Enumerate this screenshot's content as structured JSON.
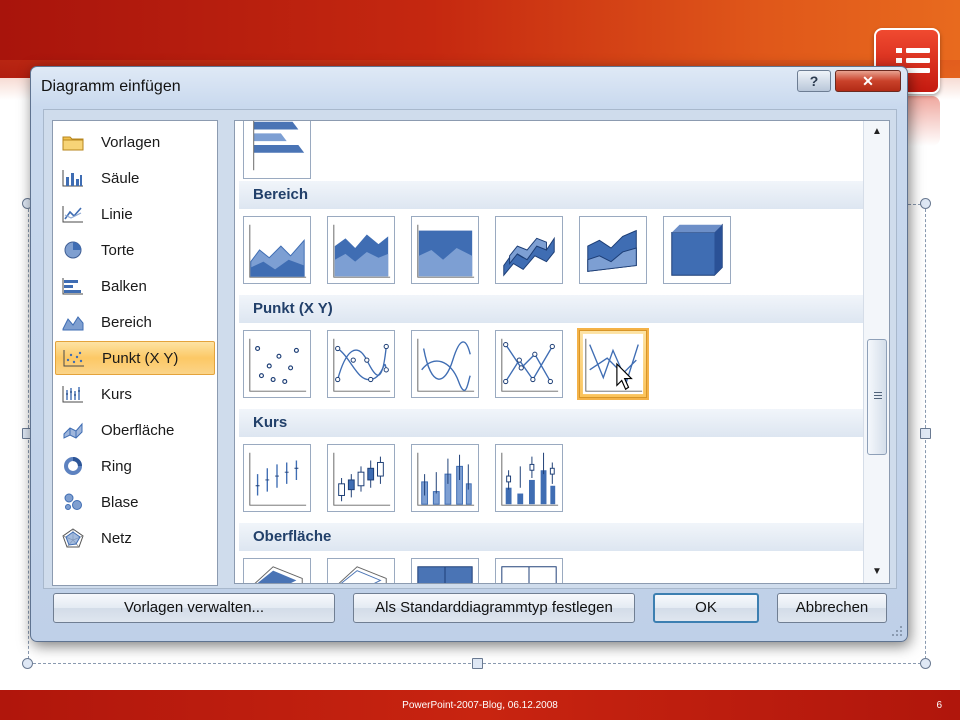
{
  "dialog": {
    "title": "Diagramm einfügen",
    "help_label": "?",
    "close_label": "✕"
  },
  "categories": [
    {
      "label": "Vorlagen",
      "icon": "folder-icon"
    },
    {
      "label": "Säule",
      "icon": "column-chart-icon"
    },
    {
      "label": "Linie",
      "icon": "line-chart-icon"
    },
    {
      "label": "Torte",
      "icon": "pie-chart-icon"
    },
    {
      "label": "Balken",
      "icon": "bar-chart-icon"
    },
    {
      "label": "Bereich",
      "icon": "area-chart-icon"
    },
    {
      "label": "Punkt (X Y)",
      "icon": "scatter-chart-icon",
      "selected": true
    },
    {
      "label": "Kurs",
      "icon": "stock-chart-icon"
    },
    {
      "label": "Oberfläche",
      "icon": "surface-chart-icon"
    },
    {
      "label": "Ring",
      "icon": "doughnut-chart-icon"
    },
    {
      "label": "Blase",
      "icon": "bubble-chart-icon"
    },
    {
      "label": "Netz",
      "icon": "radar-chart-icon"
    }
  ],
  "sections": {
    "bereich": "Bereich",
    "punkt": "Punkt (X Y)",
    "kurs": "Kurs",
    "oberflaeche": "Oberfläche"
  },
  "buttons": {
    "manage_templates": "Vorlagen verwalten...",
    "set_default": "Als Standarddiagrammtyp festlegen",
    "ok": "OK",
    "cancel": "Abbrechen"
  },
  "slide": {
    "footer": "PowerPoint-2007-Blog,  06.12.2008",
    "page_number": "6"
  },
  "colors": {
    "accent_red": "#c52810",
    "accent_orange": "#e86a1e",
    "selection_orange": "#fbc35a",
    "chart_blue": "#4a74b5"
  },
  "scroll_position": 0.5
}
